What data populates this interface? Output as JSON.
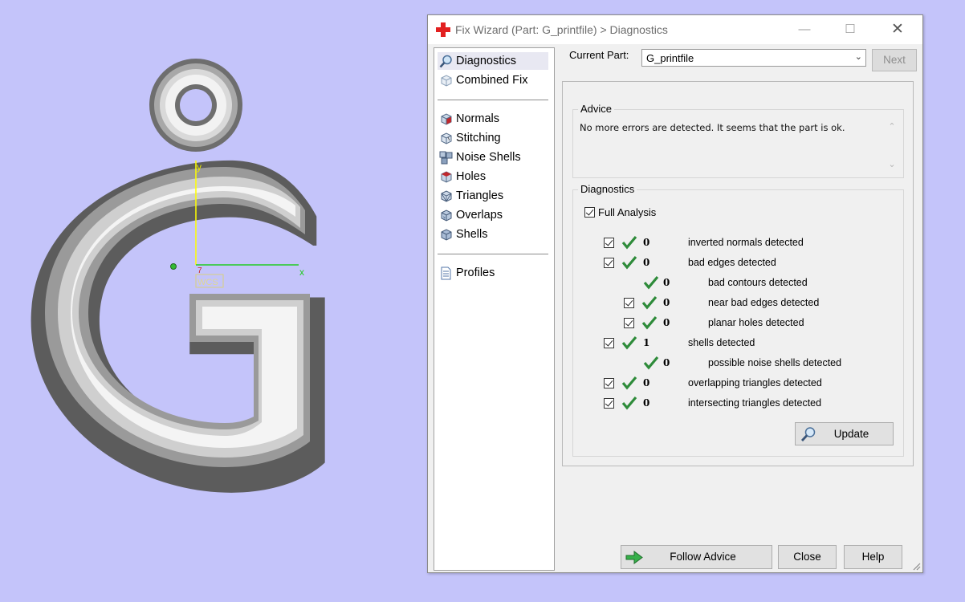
{
  "viewport": {
    "axis_y_label": "y",
    "axis_x_label": "x",
    "origin_label": "WCS",
    "colors": {
      "background": "#c4c4fa",
      "axis_y": "#ffff00",
      "axis_x": "#22cc22"
    }
  },
  "window": {
    "title": "Fix Wizard (Part: G_printfile) > Diagnostics",
    "minimize_icon": "minimize-icon",
    "maximize_icon": "maximize-icon",
    "close_icon": "close-icon"
  },
  "nav": {
    "items": [
      {
        "label": "Diagnostics",
        "icon": "magnifier-icon",
        "selected": true
      },
      {
        "label": "Combined Fix",
        "icon": "cube-icon"
      },
      {
        "label": "Normals",
        "icon": "normals-cube-icon"
      },
      {
        "label": "Stitching",
        "icon": "stitching-cube-icon"
      },
      {
        "label": "Noise Shells",
        "icon": "noise-shells-icon"
      },
      {
        "label": "Holes",
        "icon": "holes-cube-icon"
      },
      {
        "label": "Triangles",
        "icon": "triangles-cube-icon"
      },
      {
        "label": "Overlaps",
        "icon": "overlaps-cube-icon"
      },
      {
        "label": "Shells",
        "icon": "shells-cube-icon"
      },
      {
        "label": "Profiles",
        "icon": "document-icon"
      }
    ]
  },
  "current_part": {
    "label": "Current Part:",
    "value": "G_printfile"
  },
  "next_label": "Next",
  "advice": {
    "title": "Advice",
    "text": "No more errors are detected. It seems that the part is ok."
  },
  "diagnostics": {
    "title": "Diagnostics",
    "full_analysis_label": "Full Analysis",
    "rows": [
      {
        "count": "0",
        "label": "inverted normals detected"
      },
      {
        "count": "0",
        "label": "bad edges detected"
      },
      {
        "count": "0",
        "label": "bad contours detected"
      },
      {
        "count": "0",
        "label": "near bad edges detected"
      },
      {
        "count": "0",
        "label": "planar holes detected"
      },
      {
        "count": "1",
        "label": "shells detected"
      },
      {
        "count": "0",
        "label": "possible noise shells detected"
      },
      {
        "count": "0",
        "label": "overlapping triangles detected"
      },
      {
        "count": "0",
        "label": "intersecting triangles detected"
      }
    ],
    "update_label": "Update"
  },
  "buttons": {
    "follow_advice": "Follow Advice",
    "close": "Close",
    "help": "Help"
  },
  "colors": {
    "check_green": "#2e8b3a",
    "window_bg": "#f0f0f0",
    "title_red": "#e22020"
  }
}
